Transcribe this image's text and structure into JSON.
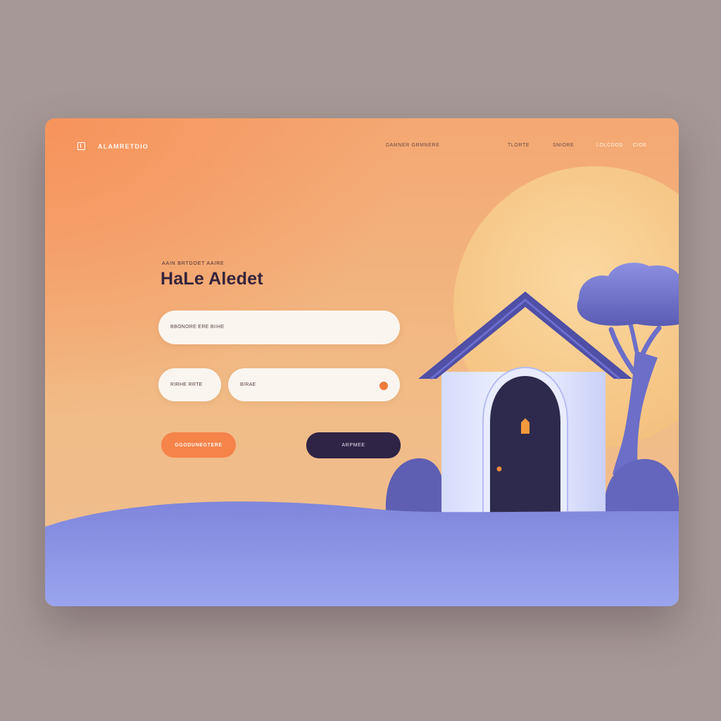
{
  "header": {
    "brand": "ALAMRETDIO",
    "nav": [
      "DAMNER GRMNERE",
      "TLORTE",
      "SNIORE",
      "LOLCDOD",
      "CIOE"
    ]
  },
  "hero": {
    "eyebrow": "AAIN BRTDOET AAIRE",
    "title": "HaLe Aledet"
  },
  "form": {
    "field_wide_placeholder": "BBONORE ERE BIIHE",
    "field_small_placeholder": "RIRHE RRTE",
    "field_mid_placeholder": "BIRAE"
  },
  "buttons": {
    "primary_label": "GGODUNEGTERE",
    "secondary_label": "ARPMEE"
  },
  "colors": {
    "accent_orange": "#f5834a",
    "dark_button": "#2f2446",
    "ground_blue": "#8e97e6",
    "sun": "#f9cf8f"
  }
}
